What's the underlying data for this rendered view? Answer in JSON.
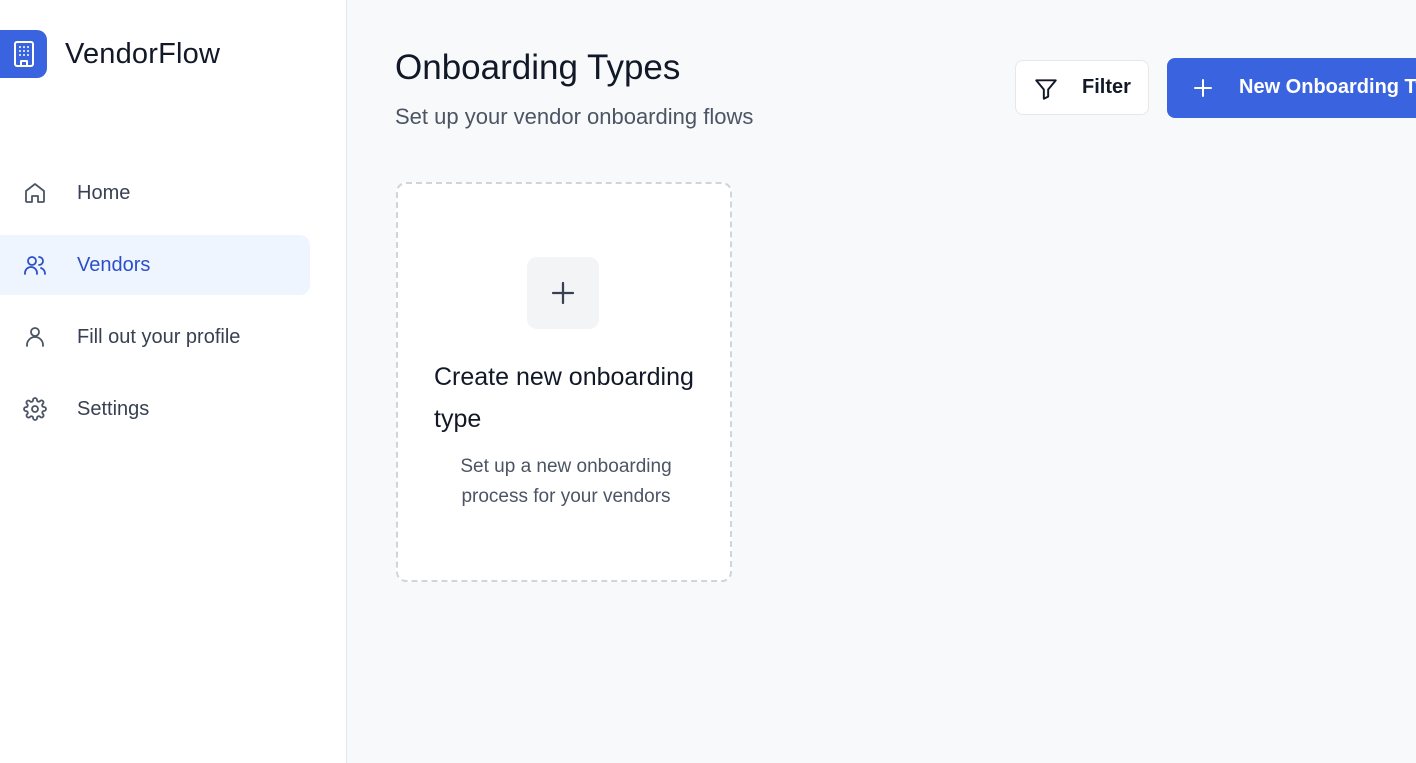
{
  "app": {
    "name": "VendorFlow",
    "logo_icon": "building-icon"
  },
  "sidebar": {
    "items": [
      {
        "label": "Home",
        "icon": "home-icon",
        "active": false
      },
      {
        "label": "Vendors",
        "icon": "users-icon",
        "active": true
      },
      {
        "label": "Fill out your profile",
        "icon": "user-icon",
        "active": false
      },
      {
        "label": "Settings",
        "icon": "gear-icon",
        "active": false
      }
    ]
  },
  "header": {
    "title": "Onboarding Types",
    "subtitle": "Set up your vendor onboarding flows",
    "filter_label": "Filter",
    "new_button_label": "New Onboarding Type"
  },
  "create_card": {
    "title": "Create new onboarding type",
    "description": "Set up a new onboarding process for your vendors"
  },
  "colors": {
    "accent": "#3a63e0",
    "active_nav_bg": "#eff5ff",
    "active_nav_text": "#2c4fc9",
    "page_bg": "#f8f9fb"
  }
}
